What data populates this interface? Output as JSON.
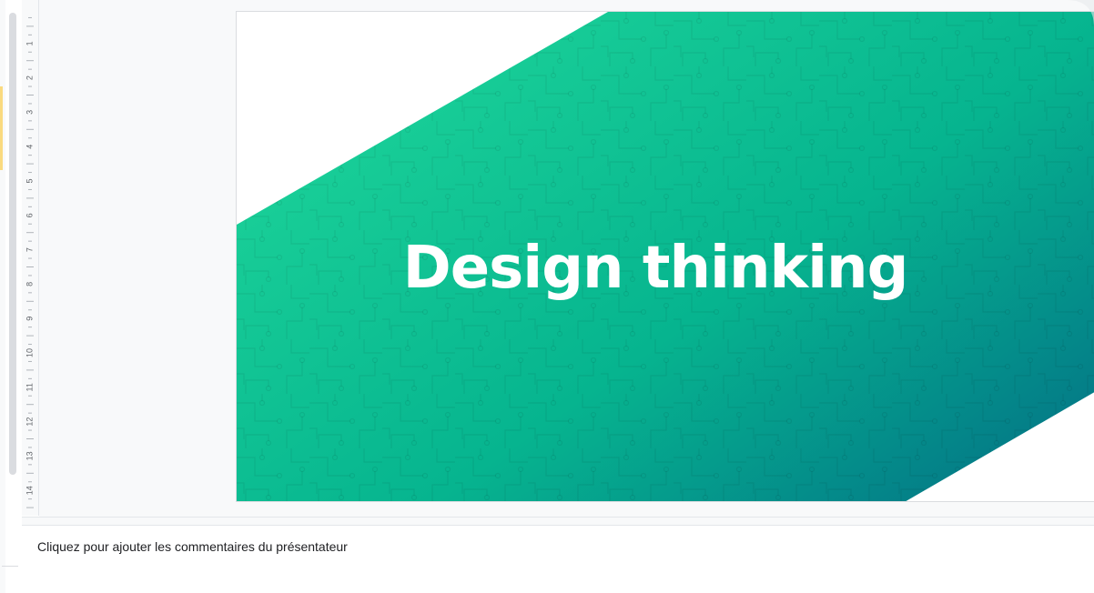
{
  "ruler": {
    "labels": [
      "1",
      "2",
      "3",
      "4",
      "5",
      "6",
      "7",
      "8",
      "9",
      "10",
      "11",
      "12",
      "13",
      "14"
    ]
  },
  "slide": {
    "title": "Design thinking",
    "colors": {
      "gradient_start": "#1ed69a",
      "gradient_mid": "#06b48f",
      "gradient_end": "#036f86",
      "title_color": "#ffffff",
      "background": "#ffffff"
    }
  },
  "notes": {
    "placeholder": "Cliquez pour ajouter les commentaires du présentateur"
  },
  "icons": {
    "divider": "drag-handle-icon"
  }
}
